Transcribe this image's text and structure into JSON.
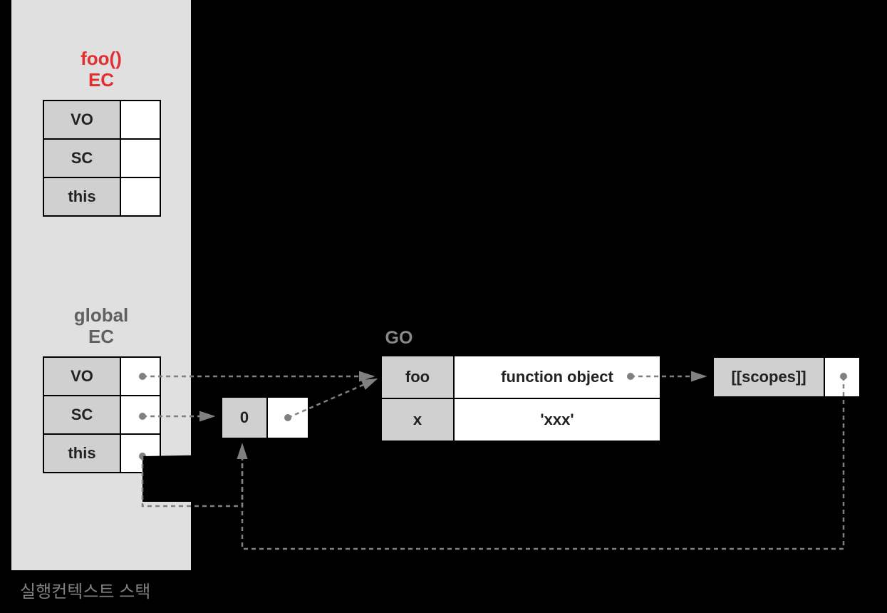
{
  "stack_caption": "실행컨텍스트 스택",
  "foo_ec": {
    "title_line1": "foo()",
    "title_line2": "EC",
    "rows": [
      "VO",
      "SC",
      "this"
    ]
  },
  "global_ec": {
    "title_line1": "global",
    "title_line2": "EC",
    "rows": [
      "VO",
      "SC",
      "this"
    ]
  },
  "zero_box": {
    "label": "0"
  },
  "go": {
    "title": "GO",
    "rows": [
      {
        "k": "foo",
        "v": "function object"
      },
      {
        "k": "x",
        "v": "'xxx'"
      }
    ]
  },
  "scopes": {
    "label": "[[scopes]]"
  }
}
